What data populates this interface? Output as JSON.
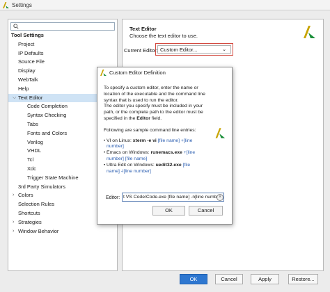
{
  "window": {
    "title": "Settings"
  },
  "search": {
    "placeholder": "",
    "icon": "search-icon"
  },
  "tree": {
    "items": [
      {
        "label": "Tool Settings",
        "level": 0,
        "arrow": ""
      },
      {
        "label": "Project",
        "level": 1,
        "arrow": ""
      },
      {
        "label": "IP Defaults",
        "level": 1,
        "arrow": ""
      },
      {
        "label": "Source File",
        "level": 1,
        "arrow": ""
      },
      {
        "label": "Display",
        "level": 1,
        "arrow": ""
      },
      {
        "label": "WebTalk",
        "level": 1,
        "arrow": ""
      },
      {
        "label": "Help",
        "level": 1,
        "arrow": ""
      },
      {
        "label": "Text Editor",
        "level": 1,
        "arrow": "⌵",
        "selected": true
      },
      {
        "label": "Code Completion",
        "level": 2,
        "arrow": ""
      },
      {
        "label": "Syntax Checking",
        "level": 2,
        "arrow": ""
      },
      {
        "label": "Tabs",
        "level": 2,
        "arrow": ""
      },
      {
        "label": "Fonts and Colors",
        "level": 2,
        "arrow": ""
      },
      {
        "label": "Verilog",
        "level": 2,
        "arrow": ""
      },
      {
        "label": "VHDL",
        "level": 2,
        "arrow": ""
      },
      {
        "label": "Tcl",
        "level": 2,
        "arrow": ""
      },
      {
        "label": "Xdc",
        "level": 2,
        "arrow": ""
      },
      {
        "label": "Trigger State Machine",
        "level": 2,
        "arrow": ""
      },
      {
        "label": "3rd Party Simulators",
        "level": 1,
        "arrow": ""
      },
      {
        "label": "Colors",
        "level": 1,
        "arrow": "›"
      },
      {
        "label": "Selection Rules",
        "level": 1,
        "arrow": ""
      },
      {
        "label": "Shortcuts",
        "level": 1,
        "arrow": ""
      },
      {
        "label": "Strategies",
        "level": 1,
        "arrow": "›"
      },
      {
        "label": "Window Behavior",
        "level": 1,
        "arrow": "›"
      }
    ]
  },
  "panel": {
    "title": "Text Editor",
    "subtitle": "Choose the text editor to use.",
    "current_editor_label": "Current Editor:",
    "current_editor_value": "Custom Editor..."
  },
  "dialog": {
    "title": "Custom Editor Definition",
    "intro_lines": [
      "To specify a custom editor, enter the name or",
      "location of the executable and the command line",
      "syntax that is used to run the editor."
    ],
    "path_line_1": "The editor you specify must be included in your",
    "path_line_2": "path, or the complete path to the editor must be",
    "path_line_3_pre": "specified in the ",
    "path_line_3_bold": "Editor",
    "path_line_3_post": " field.",
    "samples_heading": "Following are sample command line entries:",
    "samples": [
      {
        "pre": "VI on Linux: ",
        "cmd": "xterm -e vi",
        "args": " [file name] +[line",
        "args2": "number]"
      },
      {
        "pre": "Emacs on Windows: ",
        "cmd": "runemacs.exe",
        "args": " +[line",
        "args2": "number] [file name]"
      },
      {
        "pre": "Ultra Edit on Windows: ",
        "cmd": "uedit32.exe",
        "args": " [file",
        "args2": "name] -l[line number]"
      }
    ],
    "editor_label": "Editor:",
    "editor_value": "t VS Code/Code.exe [file name] -n[line numb",
    "ok_label": "OK",
    "cancel_label": "Cancel"
  },
  "footer": {
    "ok_label": "OK",
    "cancel_label": "Cancel",
    "apply_label": "Apply",
    "restore_label": "Restore..."
  },
  "colors": {
    "accent": "#2e77d0",
    "highlight_border": "#d2473d",
    "selection": "#cfe3f5",
    "brand_logo": "#c8a400"
  }
}
